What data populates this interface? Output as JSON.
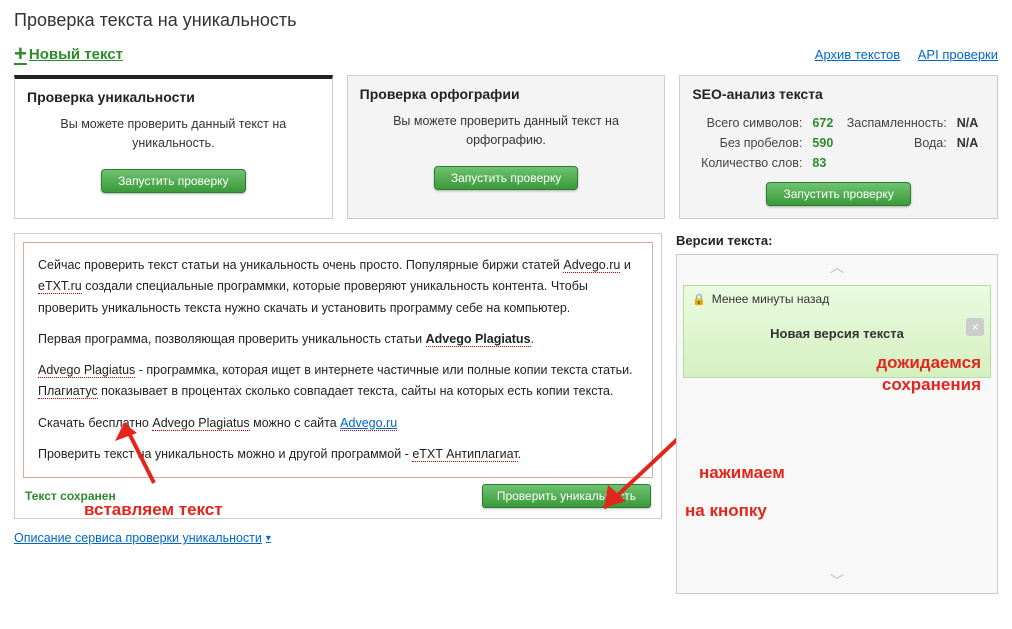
{
  "page_title": "Проверка текста на уникальность",
  "toolbar": {
    "new_text": "Новый текст",
    "archive": "Архив текстов",
    "api": "API проверки"
  },
  "cards": {
    "uniq": {
      "title": "Проверка уникальности",
      "sub": "Вы можете проверить данный текст на уникальность.",
      "btn": "Запустить проверку"
    },
    "spell": {
      "title": "Проверка орфографии",
      "sub": "Вы можете проверить данный текст на орфографию.",
      "btn": "Запустить проверку"
    },
    "seo": {
      "title": "SEO-анализ текста",
      "stats": {
        "total_label": "Всего символов:",
        "total_val": "672",
        "nospace_label": "Без пробелов:",
        "nospace_val": "590",
        "words_label": "Количество слов:",
        "words_val": "83",
        "spam_label": "Заспамленность:",
        "spam_val": "N/A",
        "water_label": "Вода:",
        "water_val": "N/A"
      },
      "btn": "Запустить проверку"
    }
  },
  "editor": {
    "p1_a": "Сейчас проверить текст статьи на уникальность очень просто.  Популярные биржи статей ",
    "p1_link1": "Advego.ru",
    "p1_b": "  и ",
    "p1_link2": "eTXT.ru",
    "p1_c": " создали специальные программки, которые проверяют уникальность контента. Чтобы проверить уникальность текста нужно скачать и установить программу себе на компьютер.",
    "p2_a": "Первая программа, позволяющая проверить уникальность статьи ",
    "p2_b": "Advego Plagiatus",
    "p2_c": ".",
    "p3_a": "Advego Plagiatus",
    "p3_b": " - программка, которая ищет  в интернете частичные или полные копии текста статьи. ",
    "p3_c": "Плагиатус",
    "p3_d": " показывает в процентах сколько совпадает текста, сайты на которых есть копии текста.",
    "p4_a": "Скачать бесплатно ",
    "p4_b": "Advego Plagiatus",
    "p4_c": " можно с сайта ",
    "p4_link": "Advego.ru",
    "p5_a": "Проверить текст на уникальность можно и другой программой - ",
    "p5_b": "eTXT Антиплагиат",
    "p5_c": ".",
    "saved": "Текст сохранен",
    "check_btn": "Проверить уникальность",
    "desc_link": "Описание сервиса проверки уникальности"
  },
  "versions": {
    "title": "Версии текста:",
    "time": "Менее минуты назад",
    "label": "Новая версия текста"
  },
  "annotations": {
    "insert": "вставляем текст",
    "press1": "нажимаем",
    "press2": "на кнопку",
    "wait1": "дожидаемся",
    "wait2": "сохранения"
  }
}
